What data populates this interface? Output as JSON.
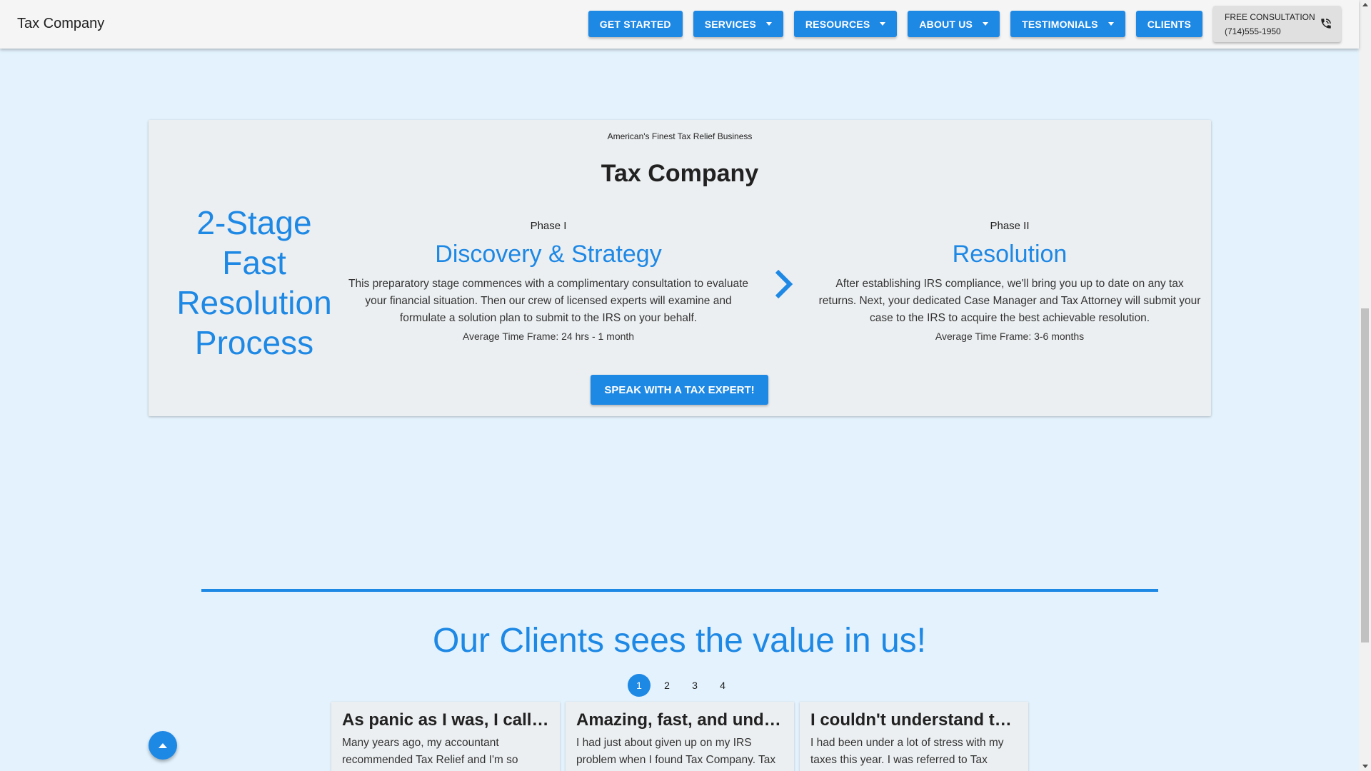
{
  "header": {
    "brand": "Tax Company",
    "nav": [
      {
        "label": "GET STARTED",
        "dropdown": false
      },
      {
        "label": "SERVICES",
        "dropdown": true
      },
      {
        "label": "RESOURCES",
        "dropdown": true
      },
      {
        "label": "ABOUT US",
        "dropdown": true
      },
      {
        "label": "TESTIMONIALS",
        "dropdown": true
      },
      {
        "label": "CLIENTS",
        "dropdown": false
      }
    ],
    "consult_label": "FREE CONSULTATION",
    "consult_phone": "(714)555-1950"
  },
  "process": {
    "tagline": "American's Finest Tax Relief Business",
    "title": "Tax Company",
    "process_title": "2-Stage Fast Resolution Process",
    "phases": [
      {
        "label": "Phase I",
        "heading": "Discovery & Strategy",
        "description": "This preparatory stage commences with a complimentary consultation to evaluate your financial situation. Then our crew of licensed experts will examine and formulate a solution plan to submit to the IRS on your behalf.",
        "time": "Average Time Frame: 24 hrs - 1 month"
      },
      {
        "label": "Phase II",
        "heading": "Resolution",
        "description": "After establishing IRS compliance, we'll bring you up to date on any tax returns. Next, your dedicated Case Manager and Tax Attorney will submit your case to the IRS to acquire the best achievable resolution.",
        "time": "Average Time Frame: 3-6 months"
      }
    ],
    "cta_label": "SPEAK WITH A TAX EXPERT!"
  },
  "clients": {
    "title": "Our Clients sees the value in us!",
    "pages": [
      "1",
      "2",
      "3",
      "4"
    ],
    "active_page": "1",
    "testimonials": [
      {
        "title": "As panic as I was, I calle...",
        "body": "Many years ago, my accountant recommended Tax Relief and I'm so grateful that I did it. The IRS..."
      },
      {
        "title": "Amazing, fast, and under...",
        "body": "I had just about given up on my IRS problem when I found Tax Company. Tax Relief helped me file..."
      },
      {
        "title": "I couldn't understand the...",
        "body": "I had been under a lot of stress with my taxes this year. I was referred to Tax Relief by a friend..."
      }
    ]
  },
  "colors": {
    "accent": "#1e88e5",
    "page_bg": "#e3f2fd",
    "card_bg": "#eceff1"
  },
  "icons": {
    "consult": "phone-icon",
    "next": "chevron-right-icon",
    "back_to_top": "arrow-up-icon"
  }
}
